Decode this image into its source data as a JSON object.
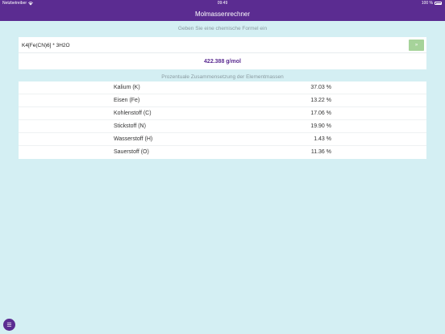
{
  "statusbar": {
    "carrier": "Netzbetreiber",
    "time": "09:49",
    "battery": "100 %"
  },
  "navbar": {
    "title": "Molmassenrechner"
  },
  "prompt": "Geben Sie eine chemische Formel ein",
  "input": {
    "value": "K4[Fe(CN)6] * 3H2O",
    "button_label": "»"
  },
  "result": {
    "molar_mass": "422.388 g/mol"
  },
  "composition": {
    "header": "Prozentuale Zusammensetzung der Elementmassen",
    "rows": [
      {
        "element": "Kalium (K)",
        "percent": "37.03 %"
      },
      {
        "element": "Eisen (Fe)",
        "percent": "13.22 %"
      },
      {
        "element": "Kohlenstoff (C)",
        "percent": "17.06 %"
      },
      {
        "element": "Stickstoff (N)",
        "percent": "19.90 %"
      },
      {
        "element": "Wasserstoff (H)",
        "percent": "1.43 %"
      },
      {
        "element": "Sauerstoff (O)",
        "percent": "11.36 %"
      }
    ]
  },
  "menu_button": {
    "icon": "hamburger-menu-icon",
    "glyph": "☰"
  },
  "colors": {
    "accent": "#5b2c91",
    "background": "#d4eff3",
    "button": "#a6d39a"
  }
}
